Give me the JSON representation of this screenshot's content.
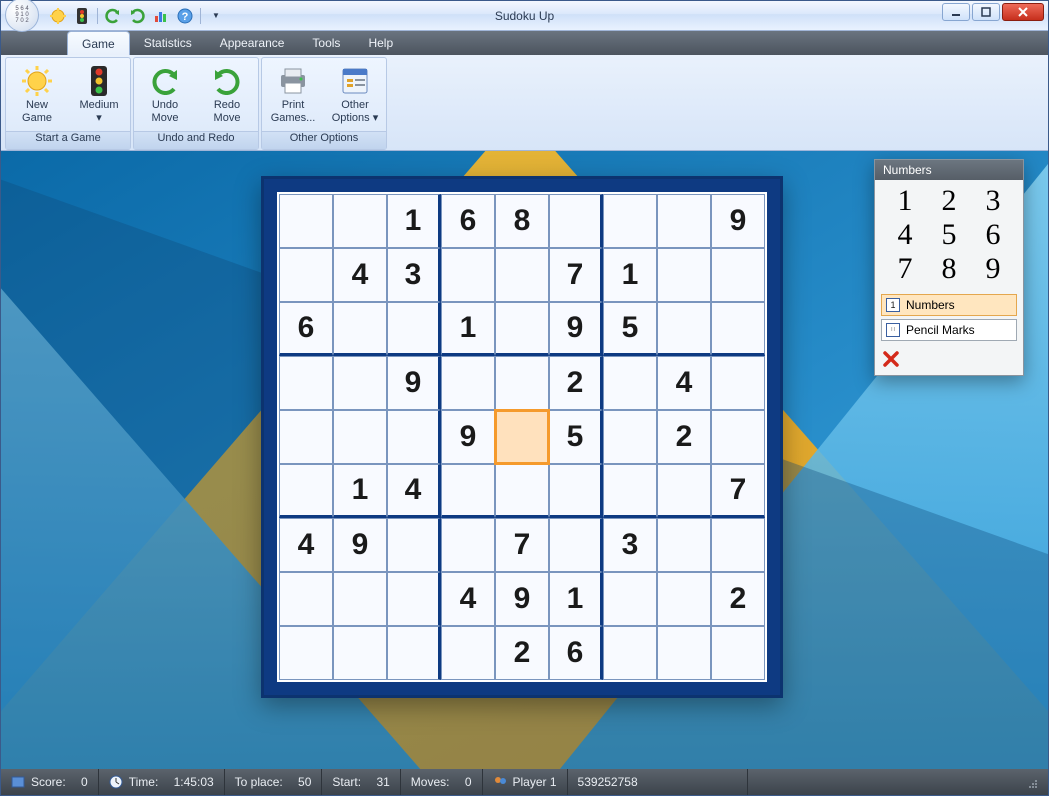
{
  "app": {
    "title": "Sudoku Up"
  },
  "qat": {
    "items": [
      "new-game",
      "difficulty",
      "sep",
      "undo",
      "redo",
      "sep",
      "stats",
      "help",
      "sep",
      "dropdown"
    ]
  },
  "menus": {
    "tabs": [
      {
        "label": "Game",
        "active": true
      },
      {
        "label": "Statistics",
        "active": false
      },
      {
        "label": "Appearance",
        "active": false
      },
      {
        "label": "Tools",
        "active": false
      },
      {
        "label": "Help",
        "active": false
      }
    ]
  },
  "ribbon": {
    "groups": [
      {
        "title": "Start a Game",
        "buttons": [
          {
            "label": "New\nGame",
            "icon": "sun",
            "name": "new-game-button"
          },
          {
            "label": "Medium\n▾",
            "icon": "traffic",
            "name": "difficulty-button"
          }
        ]
      },
      {
        "title": "Undo and Redo",
        "buttons": [
          {
            "label": "Undo\nMove",
            "icon": "undo",
            "name": "undo-button"
          },
          {
            "label": "Redo\nMove",
            "icon": "redo",
            "name": "redo-button"
          }
        ]
      },
      {
        "title": "Other Options",
        "buttons": [
          {
            "label": "Print\nGames...",
            "icon": "printer",
            "name": "print-button"
          },
          {
            "label": "Other\nOptions ▾",
            "icon": "options",
            "name": "other-options-button"
          }
        ]
      }
    ]
  },
  "board": {
    "selected_row": 4,
    "selected_col": 4,
    "cells": [
      [
        "",
        "",
        "1",
        "6",
        "8",
        "",
        "",
        "",
        "9"
      ],
      [
        "",
        "4",
        "3",
        "",
        "",
        "7",
        "1",
        "",
        ""
      ],
      [
        "6",
        "",
        "",
        "1",
        "",
        "9",
        "5",
        "",
        ""
      ],
      [
        "",
        "",
        "9",
        "",
        "",
        "2",
        "",
        "4",
        ""
      ],
      [
        "",
        "",
        "",
        "9",
        "",
        "5",
        "",
        "2",
        ""
      ],
      [
        "",
        "1",
        "4",
        "",
        "",
        "",
        "",
        "",
        "7"
      ],
      [
        "4",
        "9",
        "",
        "",
        "7",
        "",
        "3",
        "",
        ""
      ],
      [
        "",
        "",
        "",
        "4",
        "9",
        "1",
        "",
        "",
        "2"
      ],
      [
        "",
        "",
        "",
        "",
        "2",
        "6",
        "",
        "",
        ""
      ]
    ]
  },
  "palette": {
    "title": "Numbers",
    "numbers": [
      "1",
      "2",
      "3",
      "4",
      "5",
      "6",
      "7",
      "8",
      "9"
    ],
    "numbers_label": "Numbers",
    "pencil_label": "Pencil Marks"
  },
  "status": {
    "score_label": "Score:",
    "score_value": "0",
    "time_label": "Time:",
    "time_value": "1:45:03",
    "place_label": "To place:",
    "place_value": "50",
    "start_label": "Start:",
    "start_value": "31",
    "moves_label": "Moves:",
    "moves_value": "0",
    "player_label": "Player 1",
    "game_id": "539252758"
  }
}
